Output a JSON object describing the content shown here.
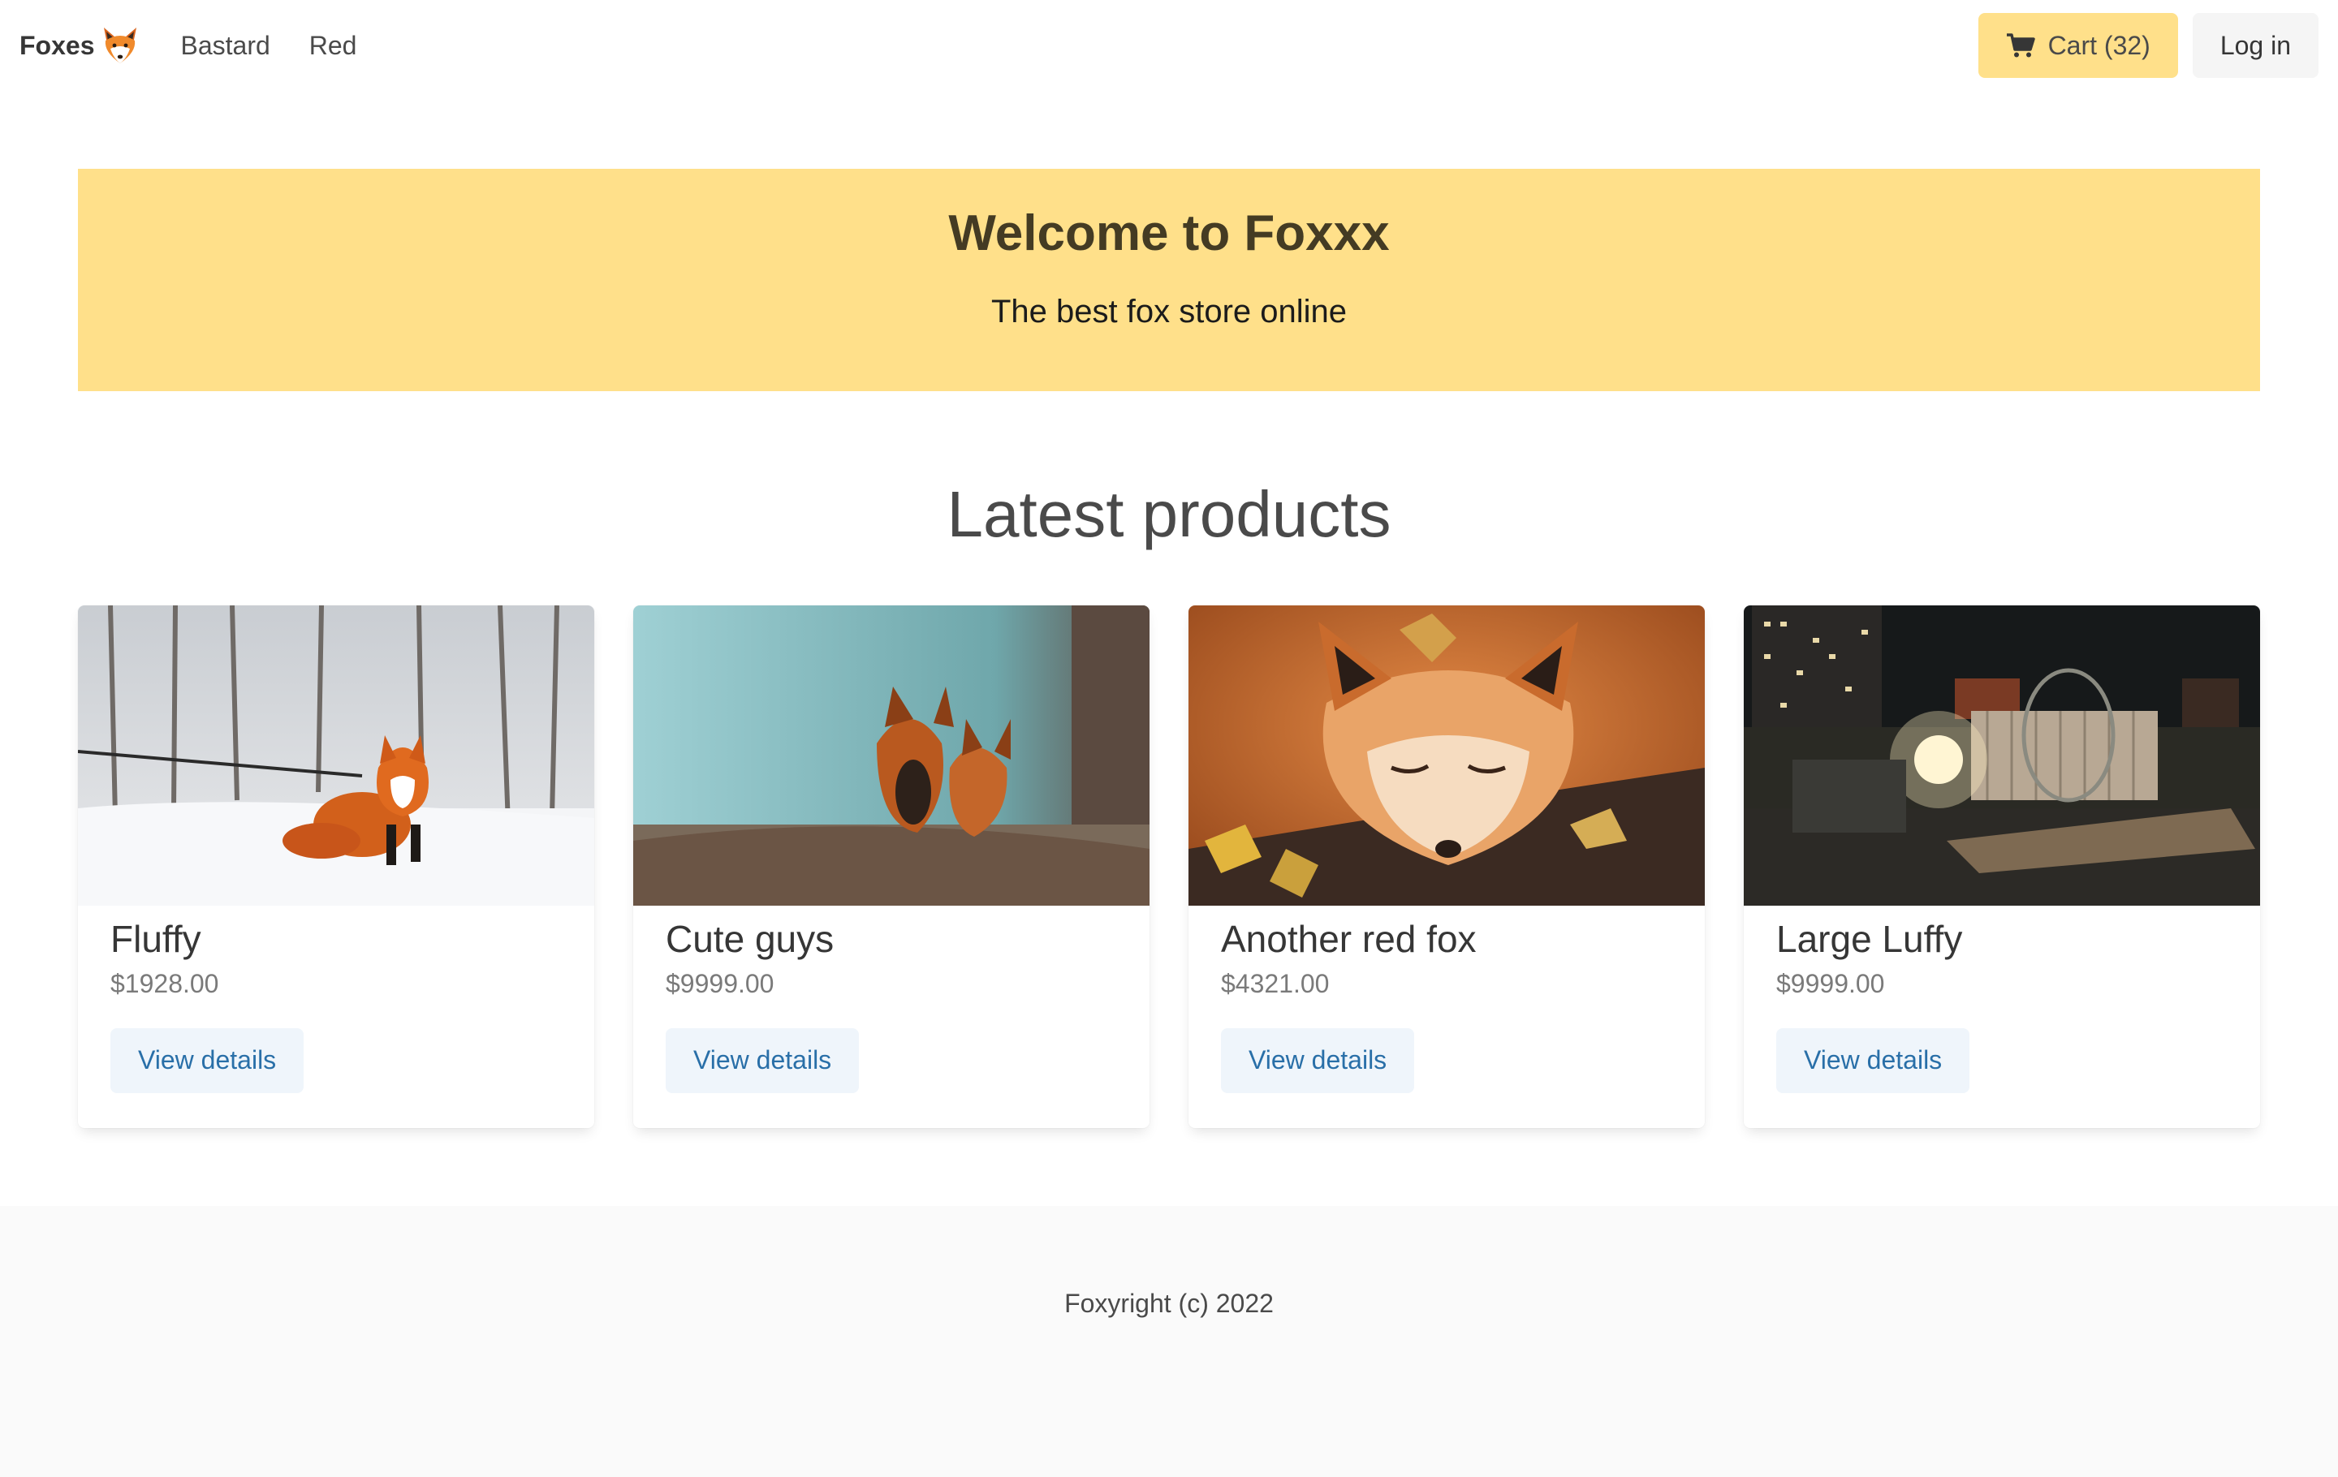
{
  "navbar": {
    "brand": "Foxes",
    "brand_icon": "fox-face-icon",
    "links": [
      "Bastard",
      "Red"
    ],
    "cart_label": "Cart (32)",
    "cart_icon": "shopping-cart-icon",
    "login_label": "Log in"
  },
  "hero": {
    "title": "Welcome to Foxxx",
    "subtitle": "The best fox store online"
  },
  "products": {
    "heading": "Latest products",
    "items": [
      {
        "name": "Fluffy",
        "price": "$1928.00",
        "button": "View details",
        "image": "fox-in-snow-photo"
      },
      {
        "name": "Cute guys",
        "price": "$9999.00",
        "button": "View details",
        "image": "fox-cubs-photo"
      },
      {
        "name": "Another red fox",
        "price": "$4321.00",
        "button": "View details",
        "image": "sleeping-fox-photo"
      },
      {
        "name": "Large Luffy",
        "price": "$9999.00",
        "button": "View details",
        "image": "night-patio-photo"
      }
    ]
  },
  "footer": {
    "text": "Foxyright (c) 2022"
  },
  "colors": {
    "accent": "#ffe08a",
    "details_button_bg": "#eff5fb",
    "details_button_text": "#296fa8",
    "footer_bg": "#fafafa"
  }
}
